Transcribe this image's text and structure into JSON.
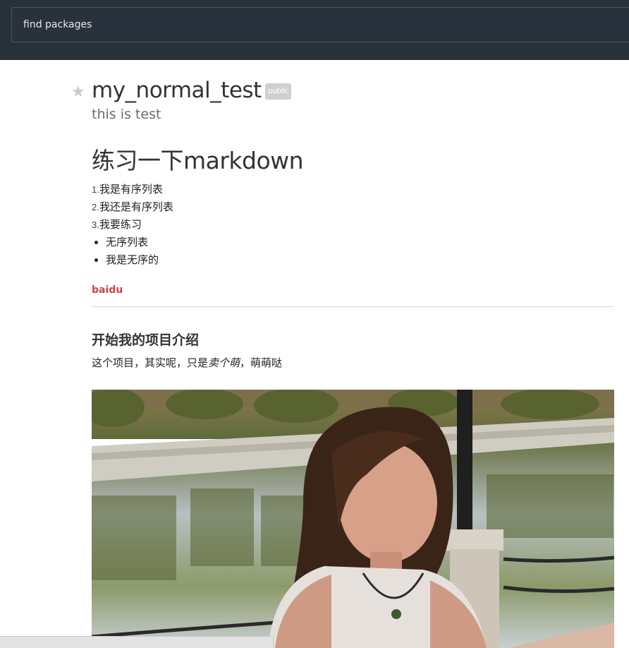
{
  "search": {
    "placeholder": "find packages"
  },
  "package": {
    "name": "my_normal_test",
    "badge": "public",
    "description": "this is test",
    "star_icon": "star-icon"
  },
  "readme": {
    "heading1": "练习一下markdown",
    "ordered": [
      {
        "num": "1.",
        "text": "我是有序列表"
      },
      {
        "num": "2.",
        "text": "我还是有序列表"
      },
      {
        "num": "3.",
        "text": "我要练习"
      }
    ],
    "unordered": [
      "无序列表",
      "我是无序的"
    ],
    "link": "baidu",
    "heading2": "开始我的项目介绍",
    "para_before": "这个项目，其实呢，只是",
    "para_em": "卖个萌",
    "para_after": "，萌萌哒"
  },
  "colors": {
    "topbar": "#283039",
    "link": "#c7474a",
    "badge": "#cfcfcf"
  }
}
